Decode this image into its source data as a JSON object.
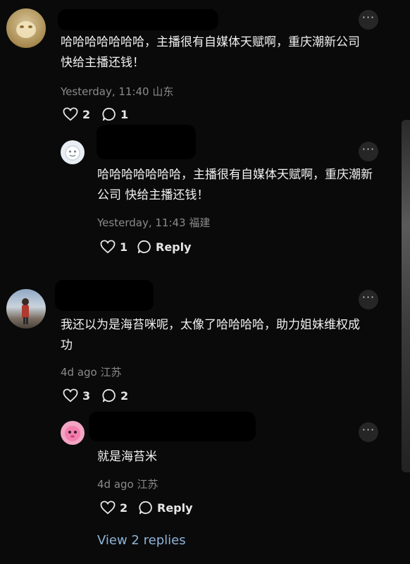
{
  "comments": [
    {
      "text": "哈哈哈哈哈哈哈，主播很有自媒体天赋啊，重庆潮新公司 快给主播还钱！",
      "meta": "Yesterday, 11:40 山东",
      "likes": "2",
      "replies": "1"
    },
    {
      "text": "哈哈哈哈哈哈哈，主播很有自媒体天赋啊，重庆潮新公司 快给主播还钱！",
      "meta": "Yesterday, 11:43 福建",
      "likes": "1",
      "reply_label": "Reply"
    },
    {
      "text": "我还以为是海苔咪呢，太像了哈哈哈哈，助力姐妹维权成功",
      "meta": "4d ago 江苏",
      "likes": "3",
      "replies": "2"
    },
    {
      "text": "就是海苔米",
      "meta": "4d ago 江苏",
      "likes": "2",
      "reply_label": "Reply"
    }
  ],
  "view_replies": "View 2 replies",
  "more_glyph": "···",
  "icons": {
    "like": "heart-icon",
    "comment": "comment-bubble-icon",
    "reply": "reply-bubble-icon",
    "more": "more-dots-icon"
  },
  "colors": {
    "background": "#0a0a0a",
    "text": "#f1f1f1",
    "meta": "#8a8a8a",
    "link": "#8fb3d9"
  }
}
